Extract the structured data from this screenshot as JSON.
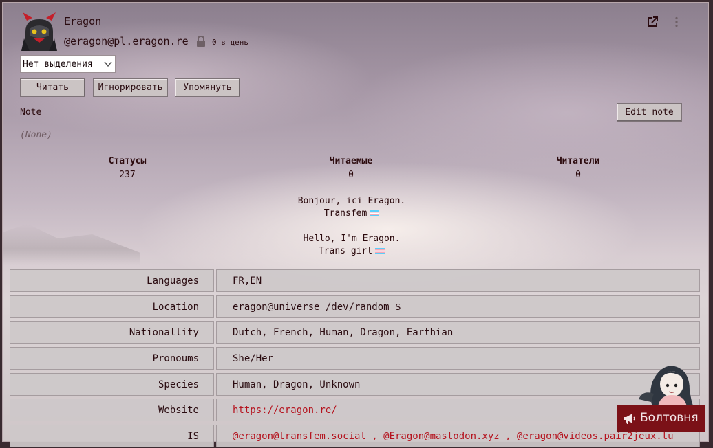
{
  "profile": {
    "display_name": "Eragon",
    "handle": "@eragon@pl.eragon.re",
    "posts_per_day": "0 в день"
  },
  "highlight_select": {
    "value": "Нет выделения"
  },
  "actions": {
    "follow": "Читать",
    "ignore": "Игнорировать",
    "mention": "Упомянуть"
  },
  "note": {
    "label": "Note",
    "value": "(None)",
    "edit_label": "Edit note"
  },
  "stats": [
    {
      "label": "Статусы",
      "value": "237"
    },
    {
      "label": "Читаемые",
      "value": "0"
    },
    {
      "label": "Читатели",
      "value": "0"
    }
  ],
  "bio": {
    "line1": "Bonjour, ici Eragon.",
    "line2": "Transfem",
    "line3": "Hello, I'm Eragon.",
    "line4": "Trans girl"
  },
  "fields": [
    {
      "name": "Languages",
      "value": "FR,EN"
    },
    {
      "name": "Location",
      "value": "eragon@universe /dev/random $"
    },
    {
      "name": "Nationallity",
      "value": "Dutch, French, Human, Dragon, Earthian"
    },
    {
      "name": "Pronoums",
      "value": "She/Her"
    },
    {
      "name": "Species",
      "value": "Human, Dragon, Unknown"
    },
    {
      "name": "Website",
      "value": "https://eragon.re/"
    },
    {
      "name": "IS",
      "value": "@eragon@transfem.social , @Eragon@mastodon.xyz , @eragon@videos.pair2jeux.tu"
    }
  ],
  "chat": {
    "label": "Болтовня"
  },
  "icons": {
    "external_link": "external-link-icon",
    "menu": "vertical-ellipsis-icon",
    "lock": "lock-icon",
    "chevron": "chevron-down-icon",
    "megaphone": "megaphone-icon"
  },
  "colors": {
    "accent": "#7b1117",
    "link": "#b5141f",
    "text": "#2a0b10"
  }
}
